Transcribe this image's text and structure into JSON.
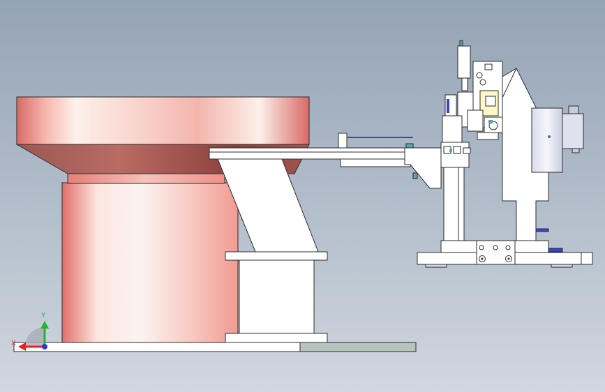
{
  "viewport": {
    "background_top": "#95a3b6",
    "background_bottom": "#d0d7df"
  },
  "colors": {
    "bowl_shade": "#d86a66",
    "bowl_highlight": "#fbe9e4",
    "part_fill": "#ffffff",
    "base_plate_green": "#b5c5bb",
    "machine_body": "#f4f4f4",
    "accent_blue": "#3a45c7",
    "accent_yellow": "#fff8c8",
    "edge": "#2b2b2b"
  },
  "triad": {
    "x_label": "X",
    "y_label": "Y",
    "x_color": "#e32222",
    "y_color": "#22b533",
    "z_color": "#2b3bd6"
  }
}
